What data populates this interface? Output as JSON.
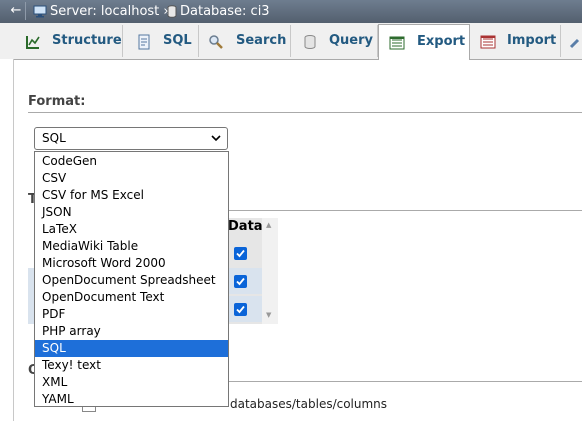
{
  "breadcrumb": {
    "back_symbol": "←",
    "server": "Server: localhost »",
    "database": "Database: ci3"
  },
  "tabs": [
    {
      "label": "Structure",
      "icon": "structure-icon"
    },
    {
      "label": "SQL",
      "icon": "sql-icon"
    },
    {
      "label": "Search",
      "icon": "search-icon"
    },
    {
      "label": "Query",
      "icon": "query-icon"
    },
    {
      "label": "Export",
      "icon": "export-icon",
      "active": true
    },
    {
      "label": "Import",
      "icon": "import-icon"
    }
  ],
  "format": {
    "label": "Format:",
    "selected": "SQL",
    "options": [
      "CodeGen",
      "CSV",
      "CSV for MS Excel",
      "JSON",
      "LaTeX",
      "MediaWiki Table",
      "Microsoft Word 2000",
      "OpenDocument Spreadsheet",
      "OpenDocument Text",
      "PDF",
      "PHP array",
      "SQL",
      "Texy! text",
      "XML",
      "YAML"
    ]
  },
  "table_header_data": "Data",
  "peek": {
    "t": "T",
    "o": "O"
  },
  "bottom_text": "databases/tables/columns",
  "colors": {
    "accent": "#1e6fd9",
    "tab_text": "#235a81",
    "topbar": "#5f6c7b"
  }
}
